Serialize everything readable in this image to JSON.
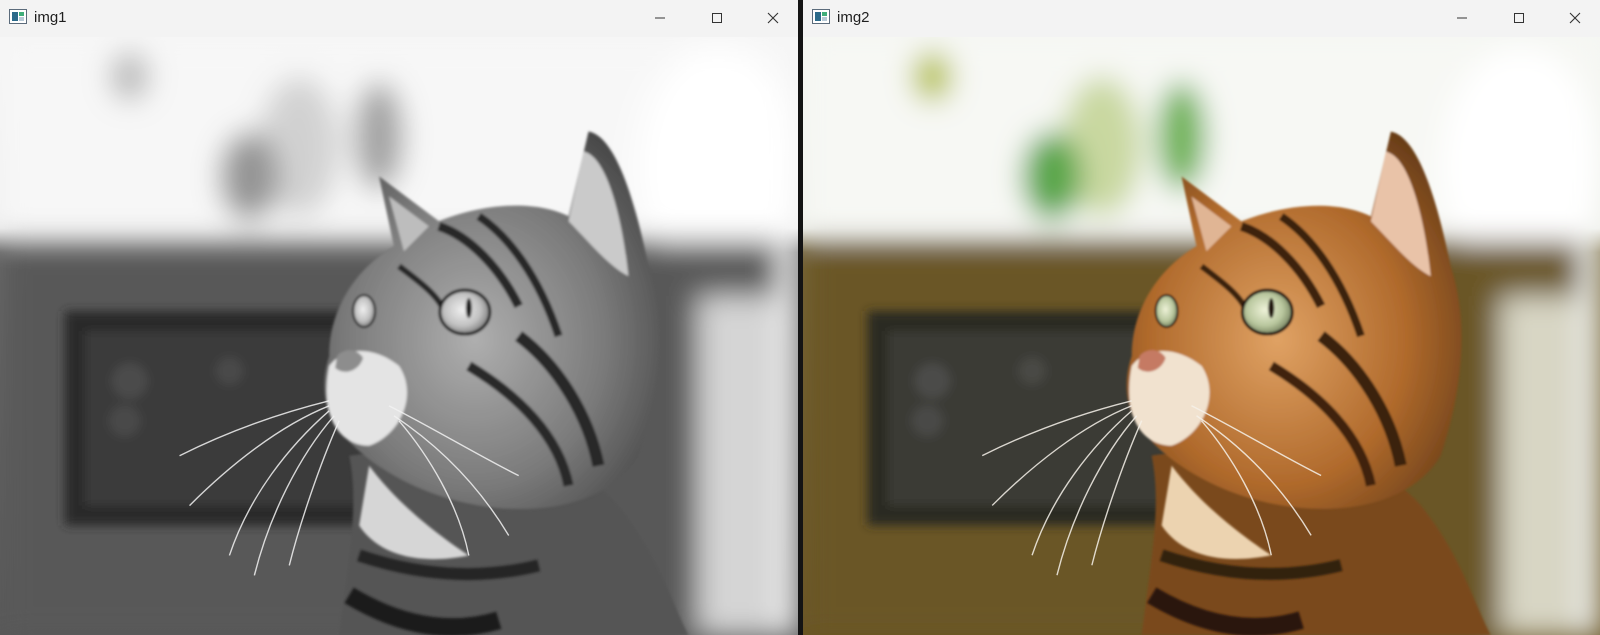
{
  "windows": [
    {
      "title": "img1",
      "variant": "grayscale"
    },
    {
      "title": "img2",
      "variant": "color"
    }
  ],
  "controls": {
    "minimize_icon": "minimize-icon",
    "maximize_icon": "maximize-icon",
    "close_icon": "close-icon"
  },
  "colors": {
    "titlebar_bg": "#f3f3f3",
    "title_text": "#1f1f1f",
    "window_gap": "#141414"
  }
}
